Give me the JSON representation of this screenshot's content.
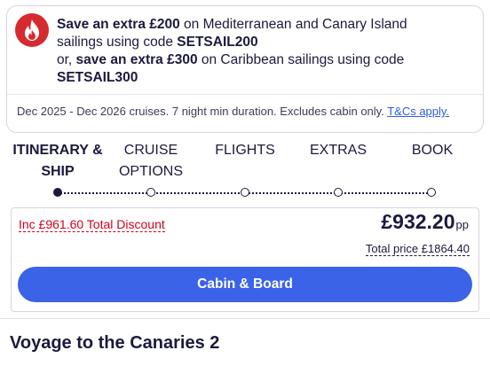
{
  "promo": {
    "line1_bold": "Save an extra £200",
    "line1_rest": " on Mediterranean and Canary Island",
    "line2_rest": "sailings using code ",
    "line2_code": "SETSAIL200",
    "line3_pre": "or, ",
    "line3_bold": "save an extra £300",
    "line3_rest": " on Caribbean sailings using code",
    "line4_code": "SETSAIL300",
    "footer_text": "Dec 2025 - Dec 2026 cruises. 7 night min duration. Excludes cabin only. ",
    "footer_link": "T&Cs apply.",
    "icon": "flame-icon",
    "icon_bg": "#d52b30"
  },
  "steps": [
    {
      "line1": "ITINERARY &",
      "line2": "SHIP",
      "active": true
    },
    {
      "line1": "CRUISE",
      "line2": "OPTIONS",
      "active": false
    },
    {
      "line1": "FLIGHTS",
      "line2": "",
      "active": false
    },
    {
      "line1": "EXTRAS",
      "line2": "",
      "active": false
    },
    {
      "line1": "BOOK",
      "line2": "",
      "active": false
    }
  ],
  "pricing": {
    "discount": "Inc £961.60 Total Discount",
    "currency": "£",
    "amount": "932.20",
    "per": "pp",
    "total": "Total price £1864.40",
    "cta": "Cabin & Board"
  },
  "heading": "Voyage to the Canaries 2",
  "colors": {
    "accent": "#3b63e7",
    "discount": "#d0021b",
    "text": "#1b1a3d"
  }
}
